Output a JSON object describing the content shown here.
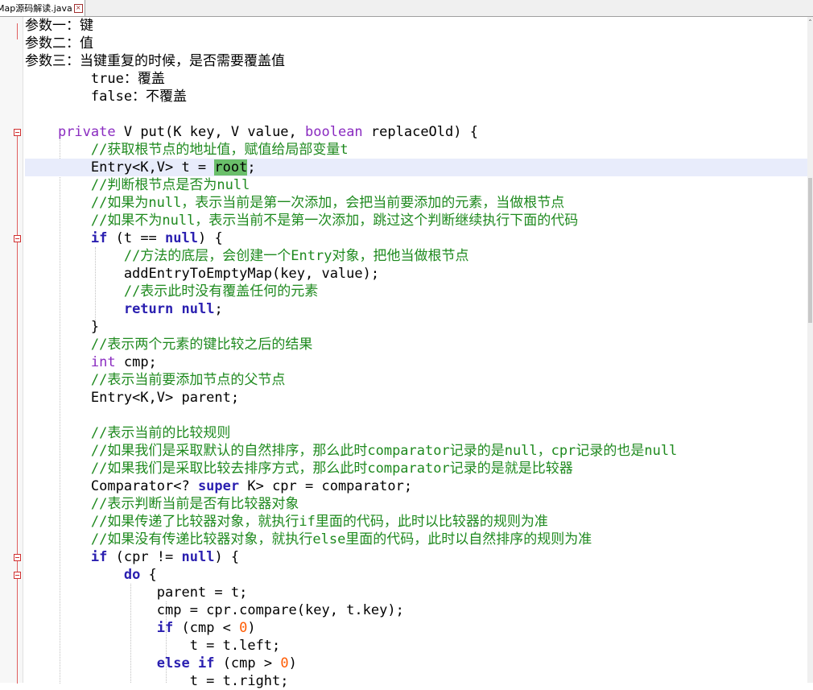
{
  "tab": {
    "label": "Map源码解读.java",
    "close_glyph": "×"
  },
  "colors": {
    "keyword": "#2a1fb0",
    "type": "#8a2bc0",
    "comment": "#1f8a1f",
    "number": "#ff5a00",
    "match_highlight": "#6abf6a",
    "current_line": "#e8ecfb"
  },
  "lines": [
    "参数一：键",
    "参数二：值",
    "参数三：当键重复的时候，是否需要覆盖值",
    "        true：覆盖",
    "        false：不覆盖",
    "",
    "    private V put(K key, V value, boolean replaceOld) {",
    "        //获取根节点的地址值，赋值给局部变量t",
    "        Entry<K,V> t = root;",
    "        //判断根节点是否为null",
    "        //如果为null，表示当前是第一次添加，会把当前要添加的元素，当做根节点",
    "        //如果不为null，表示当前不是第一次添加，跳过这个判断继续执行下面的代码",
    "        if (t == null) {",
    "            //方法的底层，会创建一个Entry对象，把他当做根节点",
    "            addEntryToEmptyMap(key, value);",
    "            //表示此时没有覆盖任何的元素",
    "            return null;",
    "        }",
    "        //表示两个元素的键比较之后的结果",
    "        int cmp;",
    "        //表示当前要添加节点的父节点",
    "        Entry<K,V> parent;",
    "",
    "        //表示当前的比较规则",
    "        //如果我们是采取默认的自然排序，那么此时comparator记录的是null，cpr记录的也是null",
    "        //如果我们是采取比较去排序方式，那么此时comparator记录的是就是比较器",
    "        Comparator<? super K> cpr = comparator;",
    "        //表示判断当前是否有比较器对象",
    "        //如果传递了比较器对象，就执行if里面的代码，此时以比较器的规则为准",
    "        //如果没有传递比较器对象，就执行else里面的代码，此时以自然排序的规则为准",
    "        if (cpr != null) {",
    "            do {",
    "                parent = t;",
    "                cmp = cpr.compare(key, t.key);",
    "                if (cmp < 0)",
    "                    t = t.left;",
    "                else if (cmp > 0)",
    "                    t = t.right;"
  ]
}
